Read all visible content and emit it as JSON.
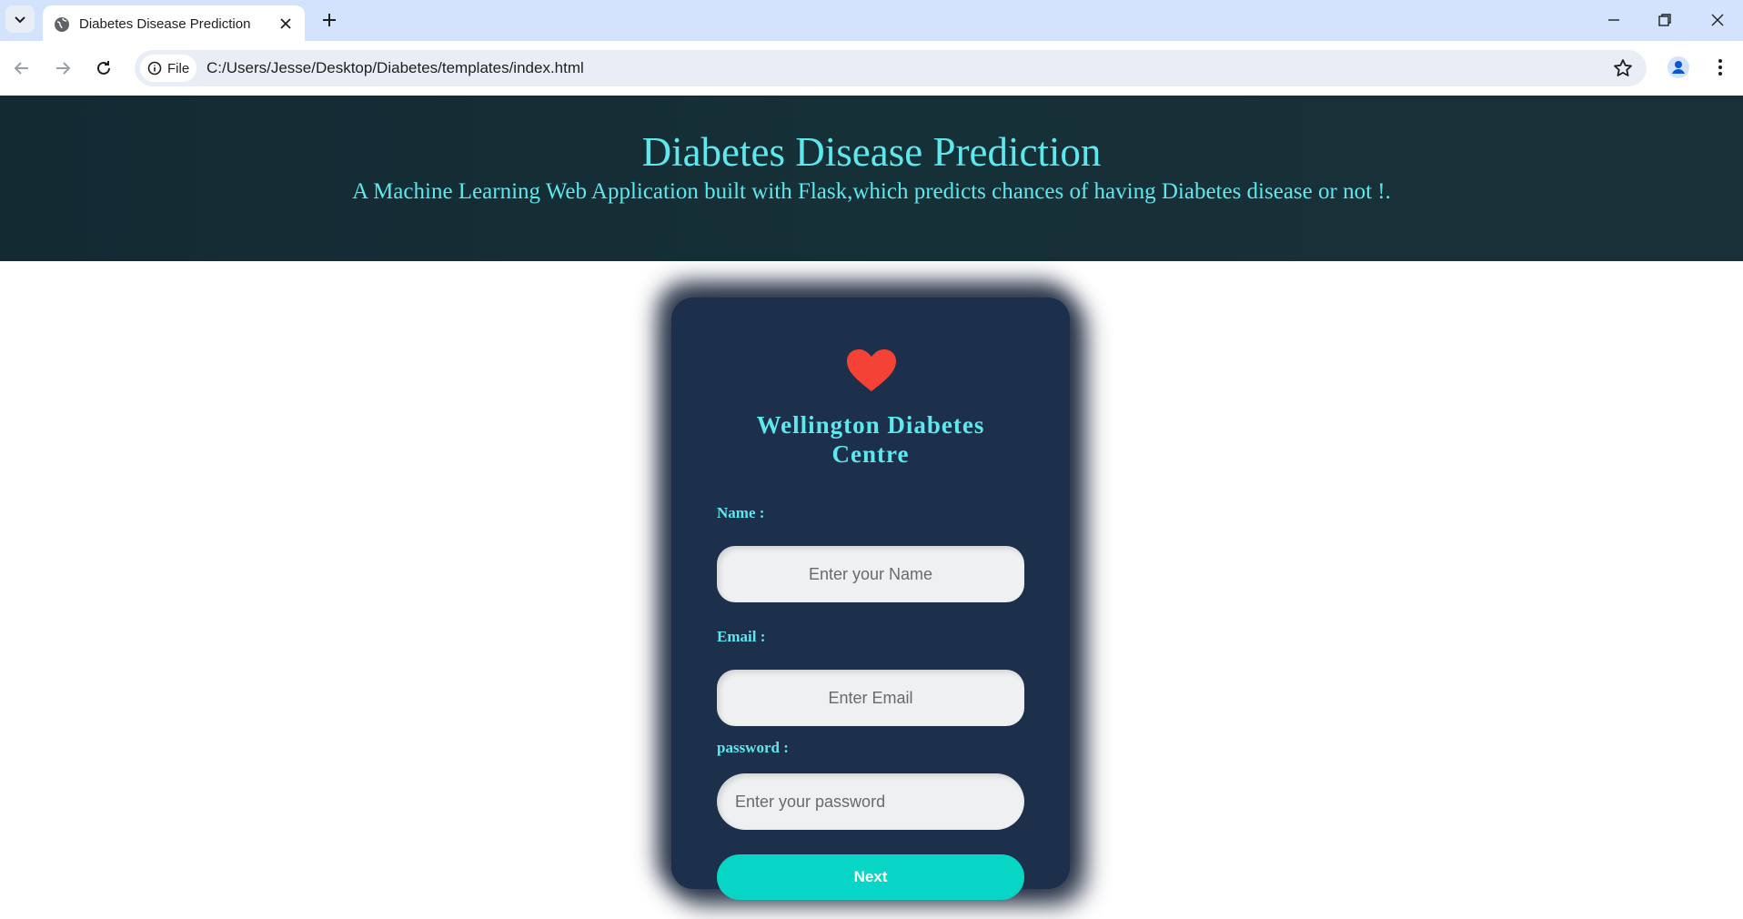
{
  "browser": {
    "tab_title": "Diabetes Disease Prediction",
    "site_chip_label": "File",
    "url": "C:/Users/Jesse/Desktop/Diabetes/templates/index.html"
  },
  "hero": {
    "title": "Diabetes Disease Prediction",
    "subtitle": "A Machine Learning Web Application built with Flask,which predicts chances of having Diabetes disease or not !."
  },
  "form": {
    "brand_line1": "Wellington Diabetes",
    "brand_line2": "Centre",
    "name_label": "Name :",
    "name_placeholder": "Enter your Name",
    "email_label": "Email :",
    "email_placeholder": "Enter Email",
    "password_label": "password :",
    "password_placeholder": "Enter your password",
    "next_label": "Next"
  },
  "icons": {
    "tab_search": "chevron-down-icon",
    "favicon": "globe-icon",
    "close": "close-icon",
    "new_tab": "plus-icon",
    "back": "arrow-left-icon",
    "forward": "arrow-right-icon",
    "reload": "reload-icon",
    "info": "info-icon",
    "bookmark": "star-icon",
    "profile": "profile-icon",
    "menu": "kebab-menu-icon",
    "heart": "heart-icon"
  },
  "colors": {
    "accent": "#5ee8ee",
    "card": "#1c2f4b",
    "hero": "#163037",
    "button": "#07d6c6",
    "heart": "#f44336"
  }
}
